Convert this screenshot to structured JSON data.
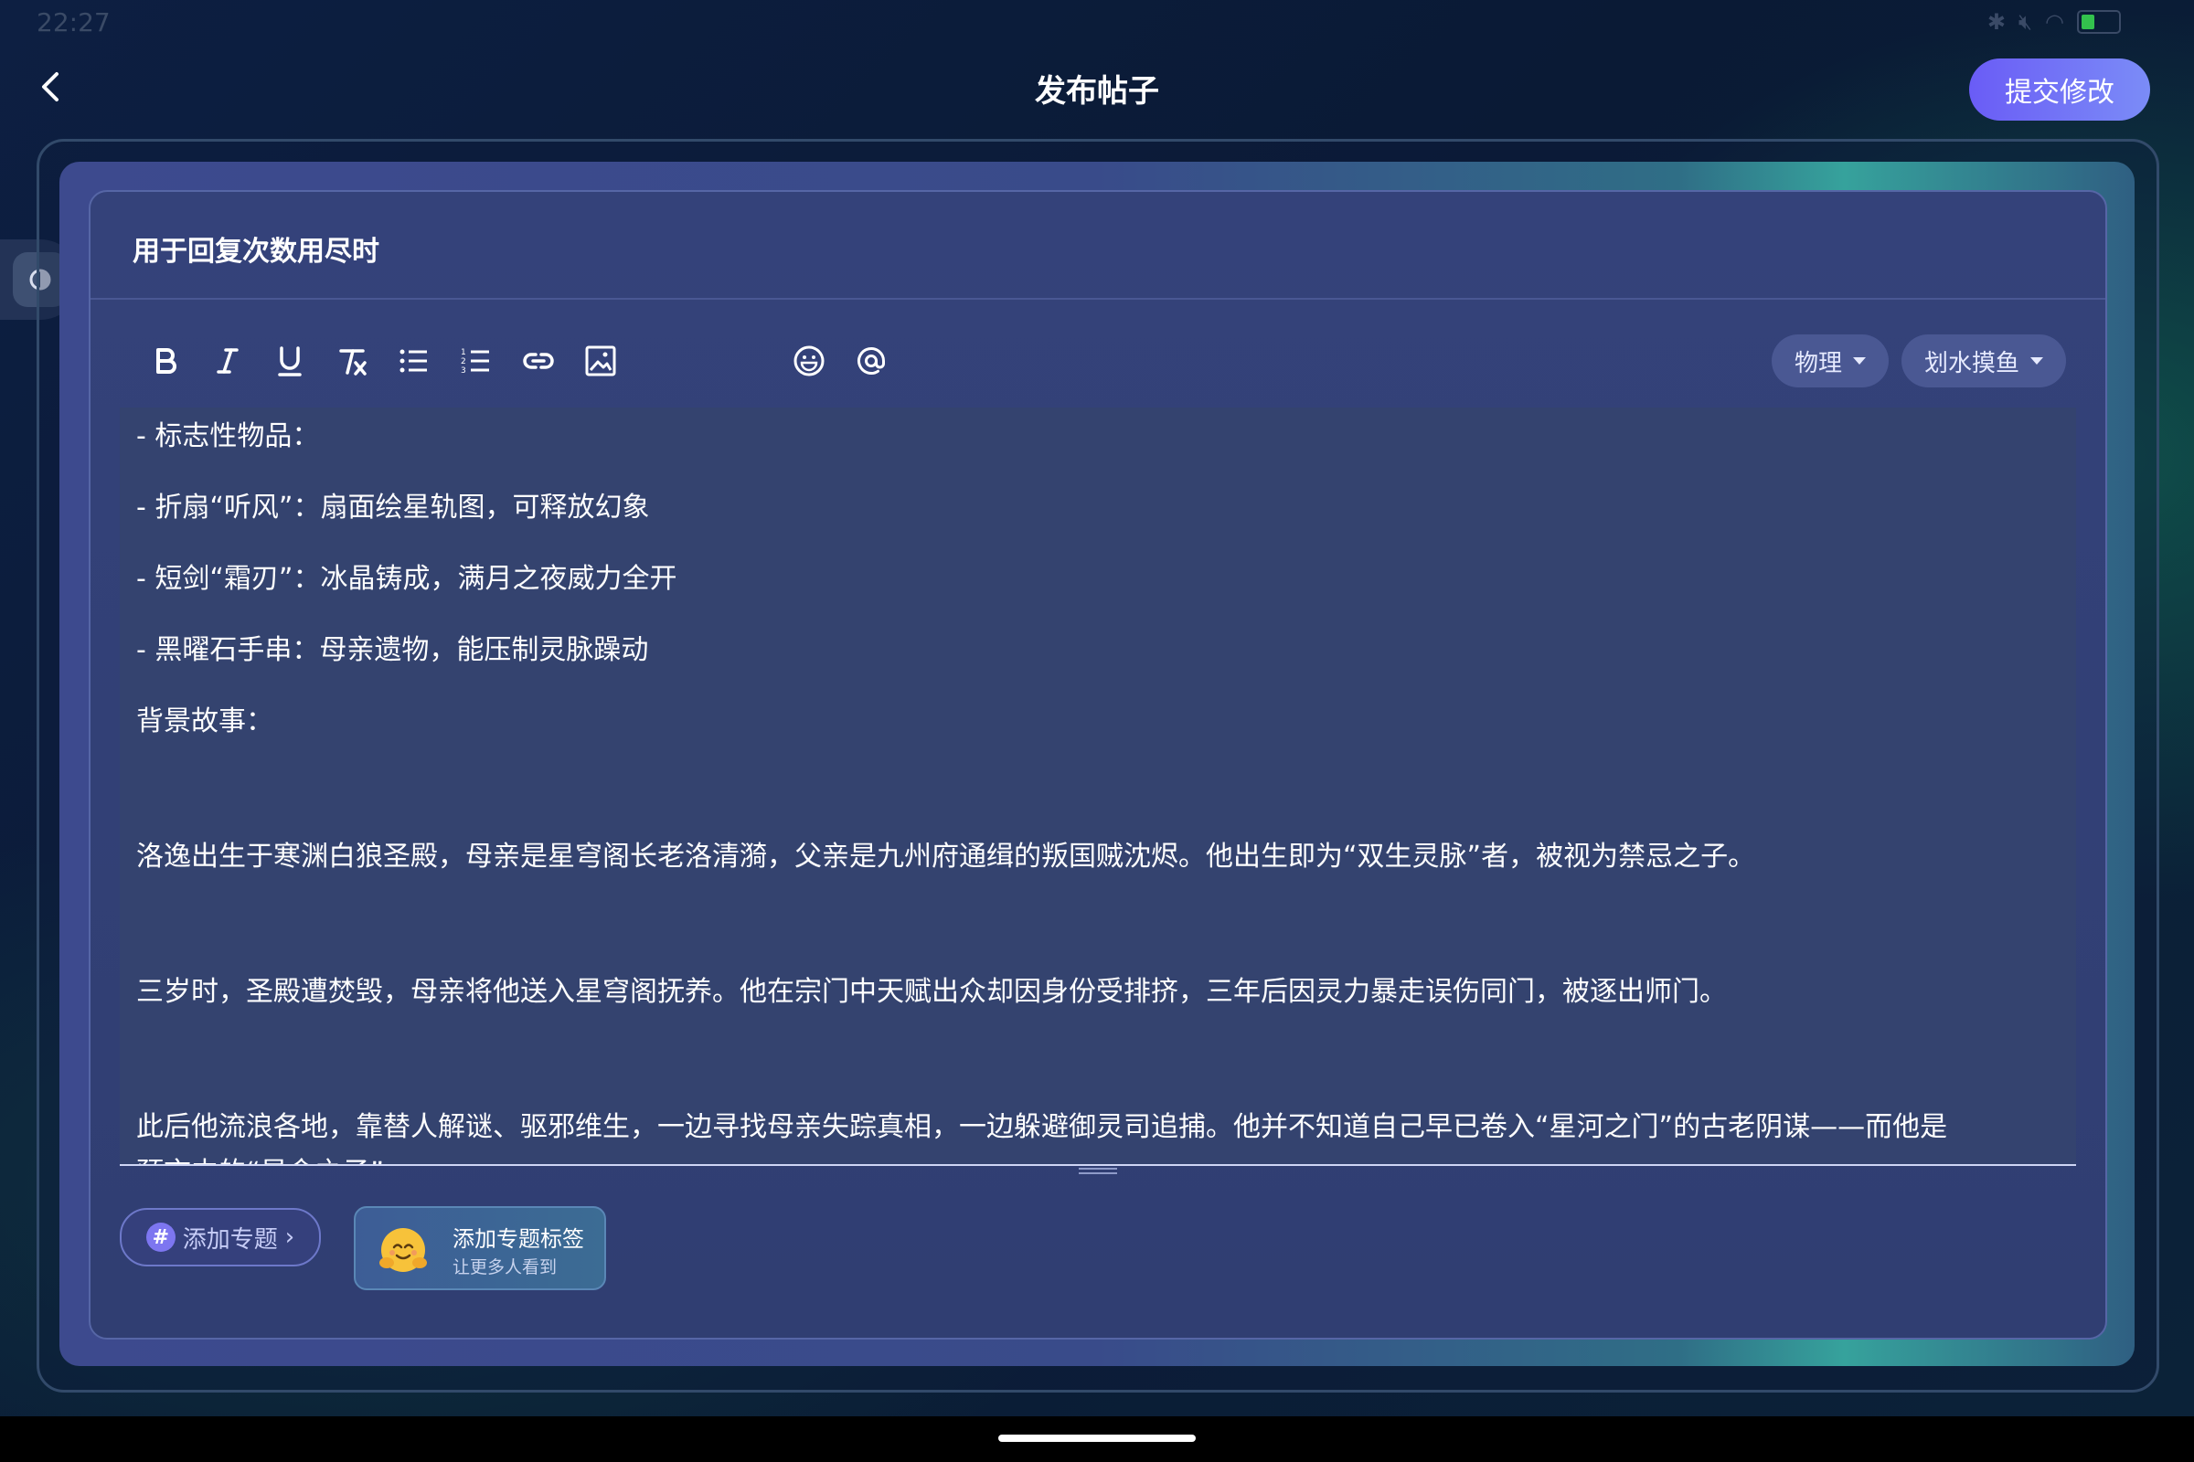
{
  "status_bar": {
    "time": "22:27",
    "icons": [
      "bluetooth-icon",
      "mute-icon",
      "wifi-icon",
      "battery-icon"
    ]
  },
  "header": {
    "title": "发布帖子",
    "submit_label": "提交修改"
  },
  "post": {
    "title": "用于回复次数用尽时"
  },
  "toolbar": {
    "tools": [
      "bold",
      "italic",
      "underline",
      "clear-format",
      "bullet-list",
      "numbered-list",
      "link",
      "image",
      "emoji",
      "mention"
    ]
  },
  "tags": {
    "category": "物理",
    "board": "划水摸鱼"
  },
  "editor": {
    "lines": [
      "- 标志性物品：",
      "  - 折扇“听风”：扇面绘星轨图，可释放幻象",
      "  - 短剑“霜刃”：冰晶铸成，满月之夜威力全开",
      "  - 黑曜石手串：母亲遗物，能压制灵脉躁动",
      "背景故事：",
      "洛逸出生于寒渊白狼圣殿，母亲是星穹阁长老洛清漪，父亲是九州府通缉的叛国贼沈烬。他出生即为“双生灵脉”者，被视为禁忌之子。",
      "三岁时，圣殿遭焚毁，母亲将他送入星穹阁抚养。他在宗门中天赋出众却因身份受排挤，三年后因灵力暴走误伤同门，被逐出师门。",
      "此后他流浪各地，靠替人解谜、驱邪维生，一边寻找母亲失踪真相，一边躲避御灵司追捕。他并不知道自己早已卷入“星河之门”的古老阴谋——而他是",
      "预言中的“星命之子”"
    ]
  },
  "footer": {
    "topic_button_label": "添加专题",
    "hint_title": "添加专题标签",
    "hint_subtitle": "让更多人看到"
  },
  "colors": {
    "accent": "#6a5cf6",
    "card_bg": "#34427a",
    "editor_bg": "#34436f"
  }
}
